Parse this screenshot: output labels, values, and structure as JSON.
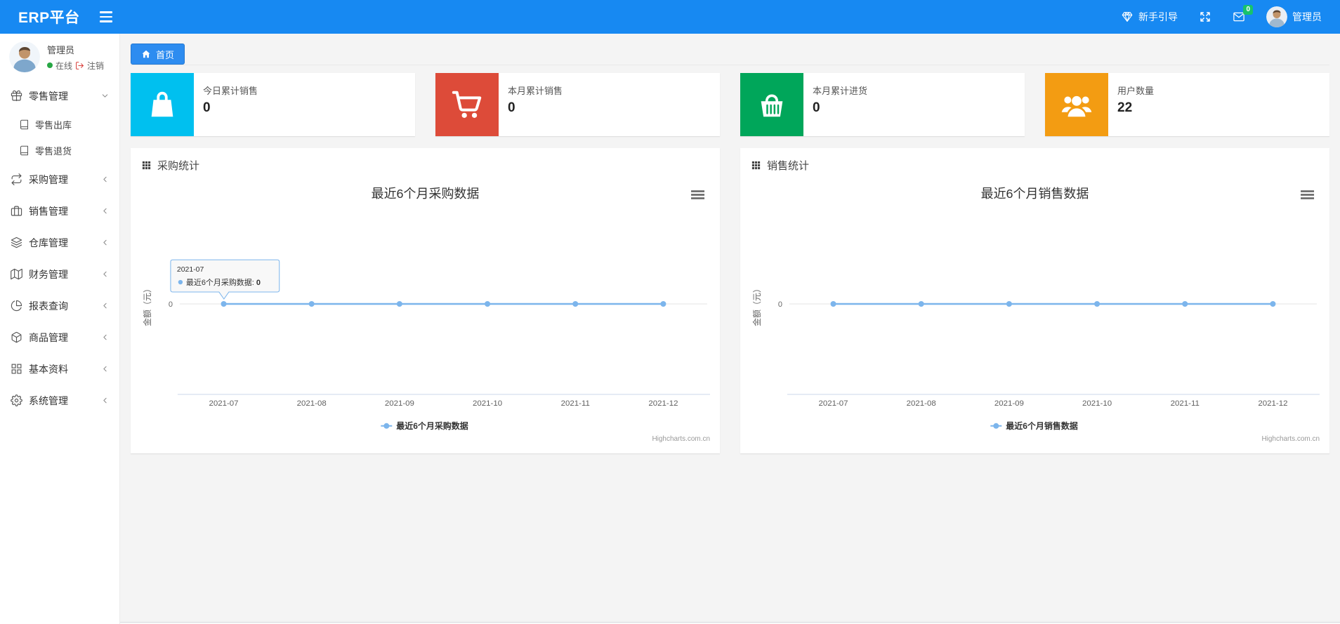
{
  "navbar": {
    "brand": "ERP平台",
    "guide_label": "新手引导",
    "mail_badge": "0",
    "username": "管理员"
  },
  "sidebar": {
    "user": {
      "name": "管理员",
      "status": "在线",
      "logout": "注销"
    },
    "menu": [
      {
        "label": "零售管理",
        "icon": "gift-icon",
        "state": "expanded",
        "children": [
          {
            "label": "零售出库",
            "icon": "journal-icon"
          },
          {
            "label": "零售退货",
            "icon": "journal-icon"
          }
        ]
      },
      {
        "label": "采购管理",
        "icon": "repeat-icon",
        "state": "collapsed"
      },
      {
        "label": "销售管理",
        "icon": "briefcase-icon",
        "state": "collapsed"
      },
      {
        "label": "仓库管理",
        "icon": "layers-icon",
        "state": "collapsed"
      },
      {
        "label": "财务管理",
        "icon": "map-icon",
        "state": "collapsed"
      },
      {
        "label": "报表查询",
        "icon": "pie-chart-icon",
        "state": "collapsed"
      },
      {
        "label": "商品管理",
        "icon": "package-icon",
        "state": "collapsed"
      },
      {
        "label": "基本资料",
        "icon": "grid-icon",
        "state": "collapsed"
      },
      {
        "label": "系统管理",
        "icon": "gear-icon",
        "state": "collapsed"
      }
    ]
  },
  "tabs": {
    "home": "首页"
  },
  "stat_cards": [
    {
      "label": "今日累计销售",
      "value": "0",
      "color": "#00c0ef",
      "icon": "shopping-bag-icon"
    },
    {
      "label": "本月累计销售",
      "value": "0",
      "color": "#dd4b39",
      "icon": "cart-icon"
    },
    {
      "label": "本月累计进货",
      "value": "0",
      "color": "#00a65a",
      "icon": "basket-icon"
    },
    {
      "label": "用户数量",
      "value": "22",
      "color": "#f39c12",
      "icon": "users-icon"
    }
  ],
  "panels": [
    {
      "header": "采购统计"
    },
    {
      "header": "销售统计"
    }
  ],
  "chart_data": [
    {
      "type": "line",
      "title": "最近6个月采购数据",
      "categories": [
        "2021-07",
        "2021-08",
        "2021-09",
        "2021-10",
        "2021-11",
        "2021-12"
      ],
      "series": [
        {
          "name": "最近6个月采购数据",
          "values": [
            0,
            0,
            0,
            0,
            0,
            0
          ],
          "color": "#7cb5ec"
        }
      ],
      "xlabel": "",
      "ylabel": "金额（元）",
      "yticks": [
        "0"
      ],
      "ylim": [
        0,
        1
      ],
      "grid": false,
      "legend_position": "bottom",
      "credit": "Highcharts.com.cn",
      "tooltip": {
        "visible": true,
        "header": "2021-07",
        "label": "最近6个月采购数据: ",
        "value": "0"
      }
    },
    {
      "type": "line",
      "title": "最近6个月销售数据",
      "categories": [
        "2021-07",
        "2021-08",
        "2021-09",
        "2021-10",
        "2021-11",
        "2021-12"
      ],
      "series": [
        {
          "name": "最近6个月销售数据",
          "values": [
            0,
            0,
            0,
            0,
            0,
            0
          ],
          "color": "#7cb5ec"
        }
      ],
      "xlabel": "",
      "ylabel": "金额（元）",
      "yticks": [
        "0"
      ],
      "ylim": [
        0,
        1
      ],
      "grid": false,
      "legend_position": "bottom",
      "credit": "Highcharts.com.cn",
      "tooltip": {
        "visible": false
      }
    }
  ]
}
